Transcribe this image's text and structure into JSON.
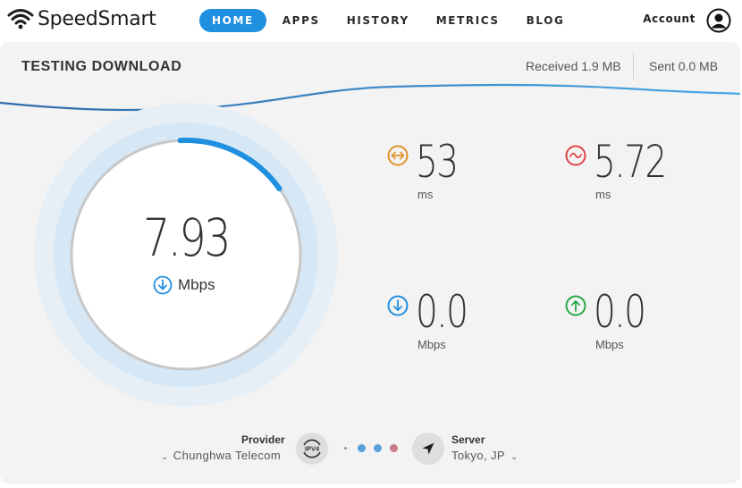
{
  "brand": {
    "name": "SpeedSmart",
    "accent": "#1f8fe0"
  },
  "nav": [
    {
      "label": "HOME",
      "active": true
    },
    {
      "label": "APPS",
      "active": false
    },
    {
      "label": "HISTORY",
      "active": false
    },
    {
      "label": "METRICS",
      "active": false
    },
    {
      "label": "BLOG",
      "active": false
    }
  ],
  "account": {
    "label": "Account",
    "icon": "user-circle-icon"
  },
  "test": {
    "title": "TESTING DOWNLOAD",
    "received": "Received 1.9 MB",
    "sent": "Sent 0.0 MB"
  },
  "gauge": {
    "value": "7.93",
    "unit": "Mbps",
    "icon": "download-arrow-icon",
    "progress_fraction": 0.16
  },
  "metrics": {
    "ping": {
      "value": "53",
      "unit": "ms",
      "icon": "ping-arrows-icon",
      "color": "#e0932a"
    },
    "jitter": {
      "value": "5.72",
      "unit": "ms",
      "icon": "jitter-wave-icon",
      "color": "#e04545"
    },
    "download": {
      "value": "0.0",
      "unit": "Mbps",
      "icon": "download-arrow-icon",
      "color": "#1f8fe0"
    },
    "upload": {
      "value": "0.0",
      "unit": "Mbps",
      "icon": "upload-arrow-icon",
      "color": "#2aa84a"
    }
  },
  "provider": {
    "label": "Provider",
    "value": "Chunghwa Telecom",
    "badge": "IPV4"
  },
  "server": {
    "label": "Server",
    "value": "Tokyo, JP",
    "icon": "location-arrow-icon"
  }
}
